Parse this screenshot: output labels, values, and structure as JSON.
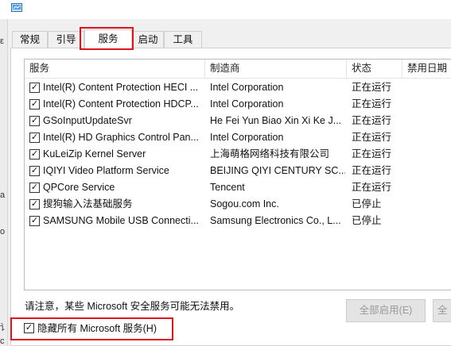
{
  "tabs": [
    {
      "label": "常规",
      "left": 0
    },
    {
      "label": "引导",
      "left": 0
    },
    {
      "label": "服务",
      "left": 0
    },
    {
      "label": "启动",
      "left": 0
    },
    {
      "label": "工具",
      "left": 0
    }
  ],
  "active_tab": "服务",
  "columns": [
    "服务",
    "制造商",
    "状态",
    "禁用日期"
  ],
  "services": [
    {
      "name": "Intel(R) Content Protection HECI ...",
      "maker": "Intel Corporation",
      "status": "正在运行",
      "checked": true
    },
    {
      "name": "Intel(R) Content Protection HDCP...",
      "maker": "Intel Corporation",
      "status": "正在运行",
      "checked": true
    },
    {
      "name": "GSoInputUpdateSvr",
      "maker": "He Fei Yun Biao Xin Xi Ke J...",
      "status": "正在运行",
      "checked": true
    },
    {
      "name": "Intel(R) HD Graphics Control Pan...",
      "maker": "Intel Corporation",
      "status": "正在运行",
      "checked": true
    },
    {
      "name": "KuLeiZip Kernel Server",
      "maker": "上海萌格网络科技有限公司",
      "status": "正在运行",
      "checked": true
    },
    {
      "name": "IQIYI Video Platform Service",
      "maker": "BEIJING QIYI CENTURY SC...",
      "status": "正在运行",
      "checked": true
    },
    {
      "name": "QPCore Service",
      "maker": "Tencent",
      "status": "正在运行",
      "checked": true
    },
    {
      "name": "搜狗输入法基础服务",
      "maker": "Sogou.com Inc.",
      "status": "已停止",
      "checked": true
    },
    {
      "name": "SAMSUNG Mobile USB Connecti...",
      "maker": "Samsung Electronics Co., L...",
      "status": "已停止",
      "checked": true
    }
  ],
  "notice": "请注意，某些 Microsoft 安全服务可能无法禁用。",
  "buttons": {
    "enable_all": "全部启用(E)",
    "disable_all": "全"
  },
  "hide_ms": {
    "label": "隐藏所有 Microsoft 服务(H)",
    "checked": true
  },
  "left_edge_glyphs": [
    "ε",
    "а",
    "o",
    "讠",
    "c"
  ],
  "colors": {
    "highlight": "#e0151b",
    "disabled_text": "#9a9a9a"
  }
}
